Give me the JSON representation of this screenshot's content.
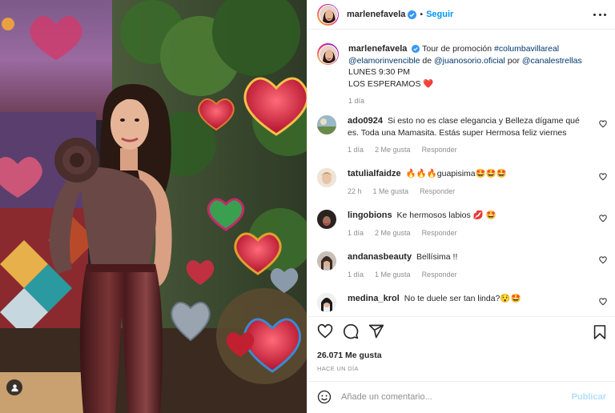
{
  "header": {
    "username": "marlenefavela",
    "separator": "•",
    "follow_label": "Seguir",
    "more_icon": "more-horizontal-icon"
  },
  "caption": {
    "username": "marlenefavela",
    "text_1": "Tour de promoción ",
    "hashtag": "#columbavillareal",
    "mention_1": "@elamorinvencible",
    "text_2": " de ",
    "mention_2": "@juanosorio.oficial",
    "text_3": " por ",
    "mention_3": "@canalestrellas",
    "text_4": " LUNES 9:30 PM",
    "line_2": "LOS ESPERAMOS ❤️",
    "time": "1 día"
  },
  "comments": [
    {
      "username": "ado0924",
      "text": "Si esto no es clase elegancia y Belleza dígame qué es. Toda una Mamasita. Estás super Hermosa feliz viernes",
      "time": "1 día",
      "likes": "2 Me gusta",
      "reply": "Responder"
    },
    {
      "username": "tatulialfaidze",
      "text": "🔥🔥🔥guapisima🤩🤩🤩",
      "time": "22 h",
      "likes": "1 Me gusta",
      "reply": "Responder"
    },
    {
      "username": "lingobions",
      "text": "Ke hermosos labios 💋 🤩",
      "time": "1 día",
      "likes": "2 Me gusta",
      "reply": "Responder"
    },
    {
      "username": "andanasbeauty",
      "text": "Bellísima !!",
      "time": "1 día",
      "likes": "1 Me gusta",
      "reply": "Responder"
    },
    {
      "username": "medina_krol",
      "text": "No te duele ser tan linda?😯🤩",
      "time": "",
      "likes": "",
      "reply": ""
    }
  ],
  "actions": {
    "likes": "26.071 Me gusta",
    "time": "HACE UN DÍA"
  },
  "add_comment": {
    "placeholder": "Añade un comentario...",
    "publish_label": "Publicar"
  },
  "colors": {
    "accent": "#0095f6",
    "link": "#00376b",
    "muted": "#8e8e8e",
    "publish_disabled": "#b2dffc",
    "verified": "#3897f0"
  }
}
